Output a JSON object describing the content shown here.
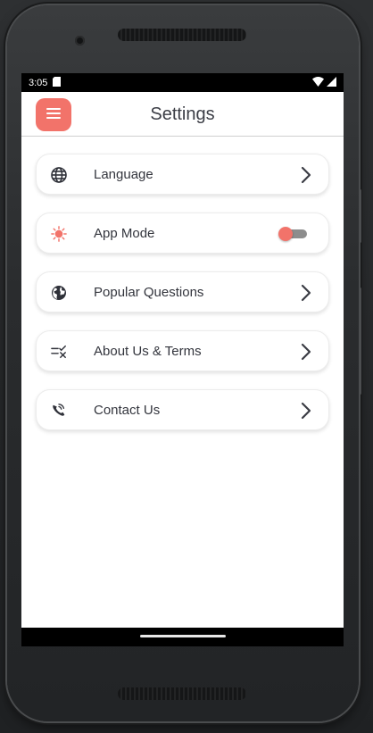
{
  "status_bar": {
    "time": "3:05"
  },
  "app_bar": {
    "title": "Settings",
    "menu_icon": "hamburger-menu-icon",
    "accent_color": "#f2736a"
  },
  "settings": [
    {
      "label": "Language",
      "icon": "globe-icon",
      "control": "chevron"
    },
    {
      "label": "App Mode",
      "icon": "sun-icon",
      "control": "toggle",
      "toggle_on": false
    },
    {
      "label": "Popular Questions",
      "icon": "earth-icon",
      "control": "chevron"
    },
    {
      "label": "About Us & Terms",
      "icon": "checklist-icon",
      "control": "chevron"
    },
    {
      "label": "Contact Us",
      "icon": "phone-call-icon",
      "control": "chevron"
    }
  ]
}
